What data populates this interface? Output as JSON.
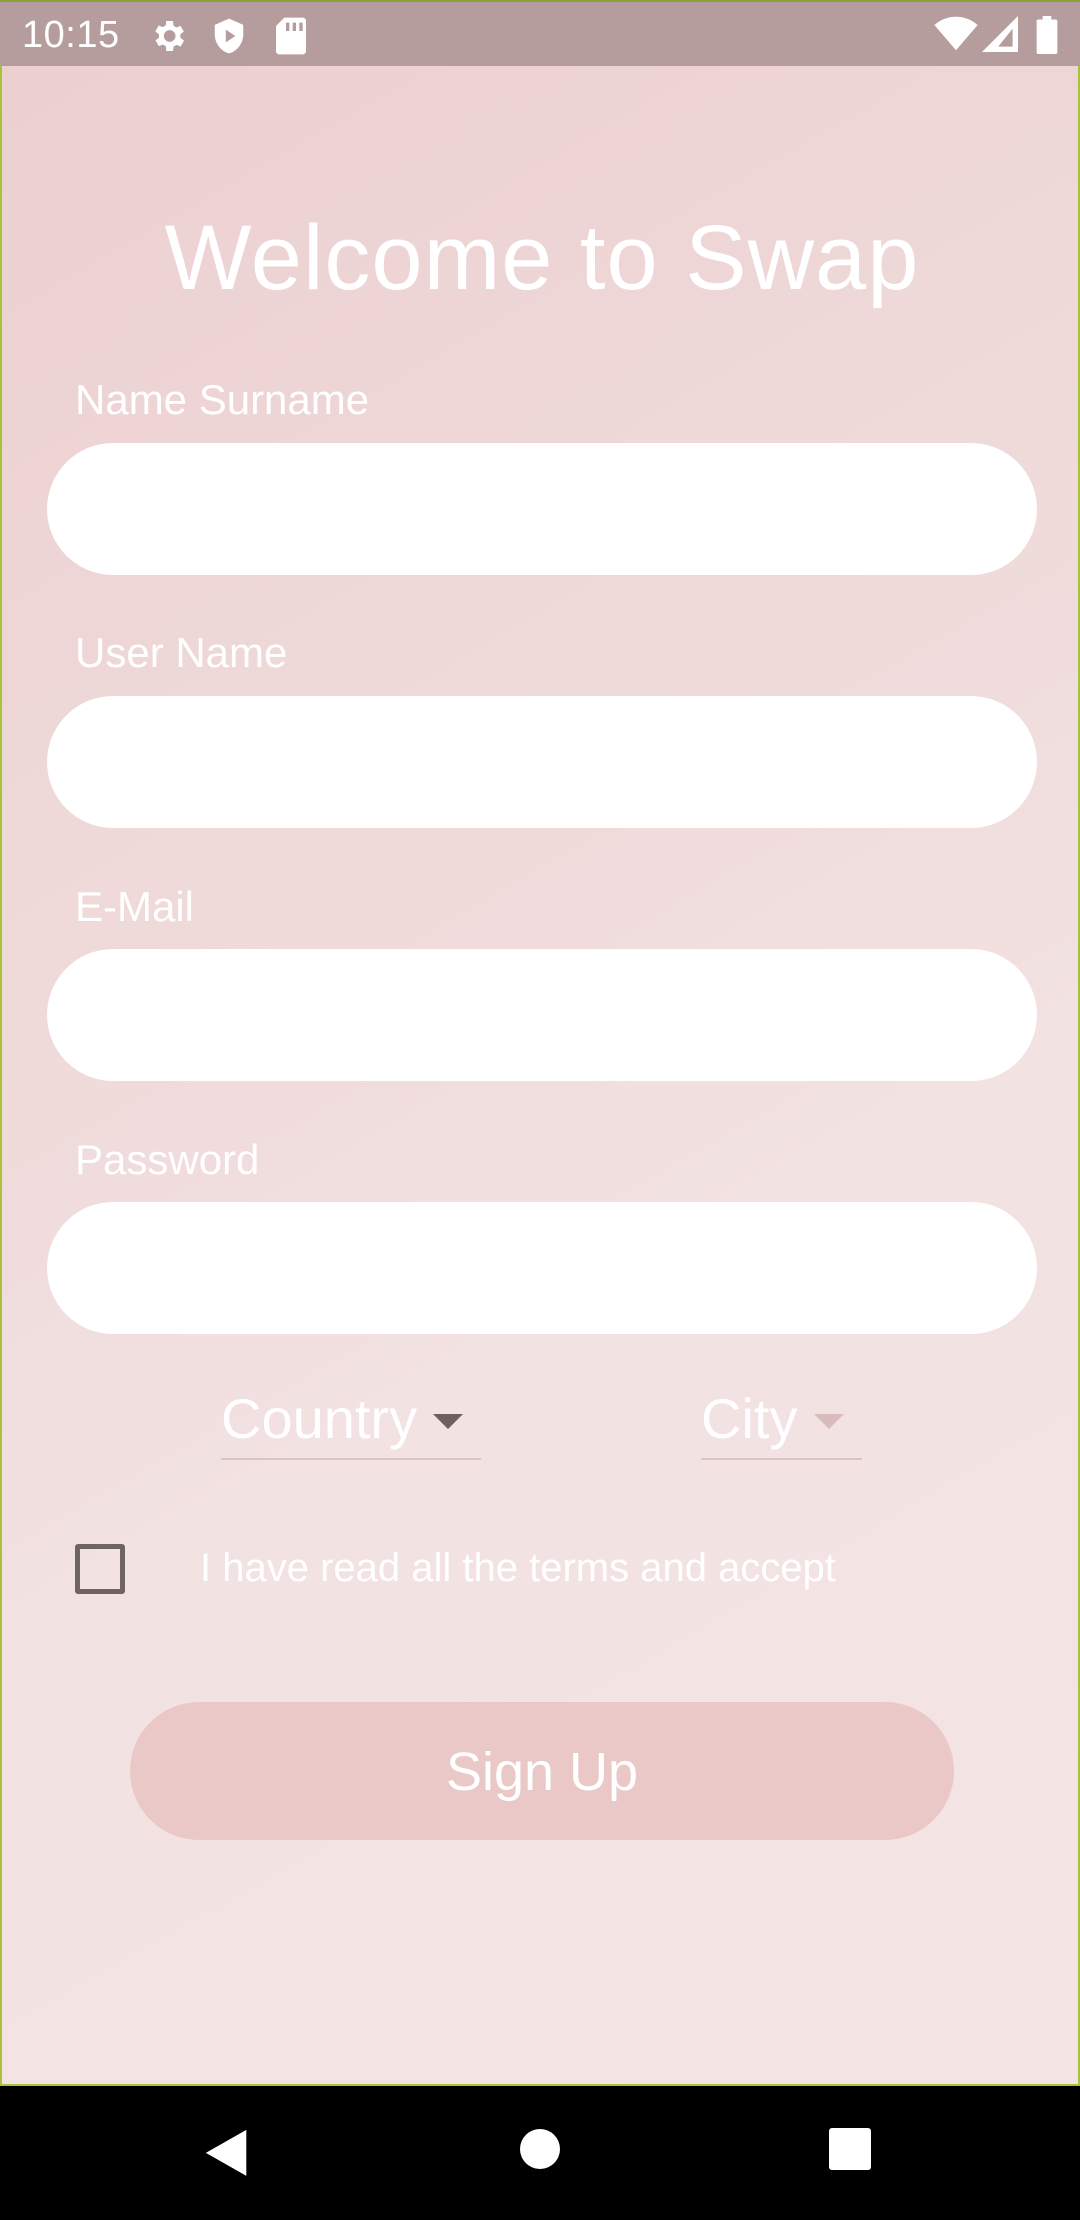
{
  "status_bar": {
    "time": "10:15",
    "left_icons": [
      "settings-icon",
      "shield-icon",
      "sd-card-icon"
    ],
    "right_icons": [
      "wifi-icon",
      "signal-icon",
      "battery-icon"
    ]
  },
  "page": {
    "title": "Welcome to Swap"
  },
  "form": {
    "fields": [
      {
        "label": "Name Surname",
        "value": ""
      },
      {
        "label": "User Name",
        "value": ""
      },
      {
        "label": "E-Mail",
        "value": ""
      },
      {
        "label": "Password",
        "value": ""
      }
    ],
    "country_dropdown": {
      "label": "Country"
    },
    "city_dropdown": {
      "label": "City"
    },
    "terms": {
      "text": "I have read all the terms and accept",
      "checked": false
    },
    "signup_label": "Sign Up"
  },
  "nav_bar": {
    "buttons": [
      "back-icon",
      "home-icon",
      "recents-icon"
    ]
  },
  "colors": {
    "status_bar": "#b59d9d",
    "background_top": "#ecd0d0",
    "background_bottom": "#f4e4e4",
    "button": "#ebc8c8",
    "text": "#ffffff",
    "checkbox_border": "#6e6464"
  }
}
